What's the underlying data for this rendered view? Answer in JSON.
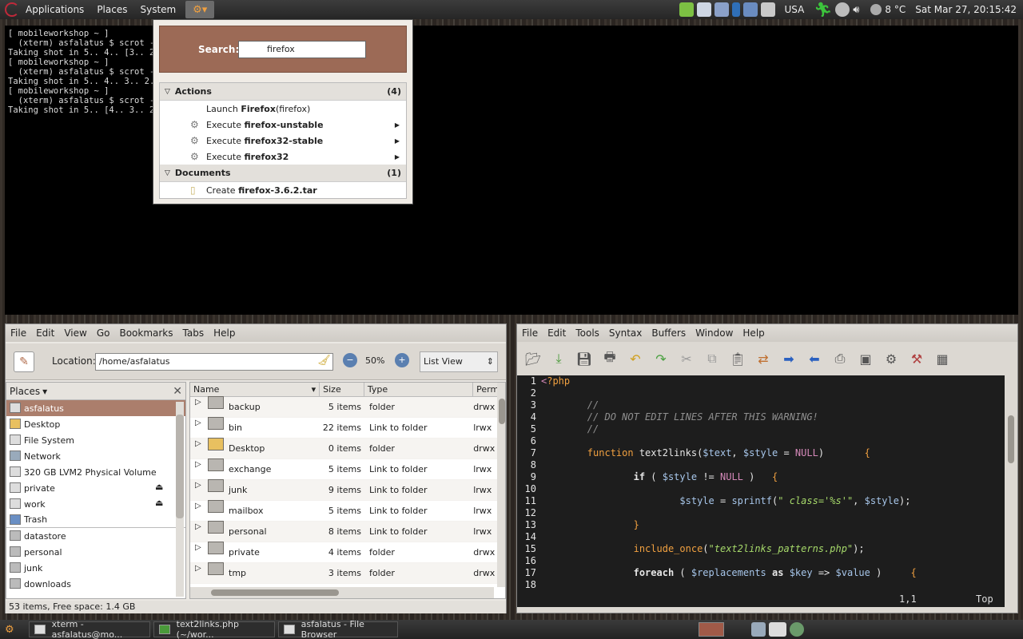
{
  "top_panel": {
    "menus": [
      "Applications",
      "Places",
      "System"
    ],
    "tray": {
      "keyboard": "USA",
      "weather": "8 °C",
      "clock": "Sat Mar 27, 20:15:42"
    }
  },
  "xterm": {
    "lines": [
      "[ mobileworkshop ~ ]",
      "  (xterm) asfalatus $ scrot -c",
      "Taking shot in 5.. 4.. [3.. 2.",
      "[ mobileworkshop ~ ]",
      "  (xterm) asfalatus $ scrot -c",
      "Taking shot in 5.. 4.. 3.. 2..",
      "[ mobileworkshop ~ ]",
      "  (xterm) asfalatus $ scrot -c",
      "Taking shot in 5.. [4.. 3.. 2."
    ]
  },
  "launcher": {
    "search_label": "Search:",
    "search_value": "firefox",
    "groups": [
      {
        "name": "Actions",
        "count": "(4)",
        "items": [
          {
            "verb": "Launch",
            "name": "Firefox",
            "extra": " (firefox)",
            "arrow": false,
            "icon": "none"
          },
          {
            "verb": "Execute",
            "name": "firefox-unstable",
            "extra": "",
            "arrow": true,
            "icon": "gears-icon"
          },
          {
            "verb": "Execute",
            "name": "firefox32-stable",
            "extra": "",
            "arrow": true,
            "icon": "gears-icon"
          },
          {
            "verb": "Execute",
            "name": "firefox32",
            "extra": "",
            "arrow": true,
            "icon": "gears-icon"
          }
        ]
      },
      {
        "name": "Documents",
        "count": "(1)",
        "items": [
          {
            "verb": "Create",
            "name": "firefox-3.6.2.tar",
            "extra": "",
            "arrow": false,
            "icon": "new-document-icon"
          }
        ]
      }
    ]
  },
  "file_browser": {
    "menus": [
      "File",
      "Edit",
      "View",
      "Go",
      "Bookmarks",
      "Tabs",
      "Help"
    ],
    "location_label": "Location:",
    "location": "/home/asfalatus",
    "zoom": "50%",
    "view_mode": "List View",
    "places_label": "Places",
    "places": [
      {
        "label": "asfalatus",
        "selected": true,
        "eject": false
      },
      {
        "label": "Desktop",
        "selected": false,
        "eject": false
      },
      {
        "label": "File System",
        "selected": false,
        "eject": false
      },
      {
        "label": "Network",
        "selected": false,
        "eject": false
      },
      {
        "label": "320 GB LVM2 Physical Volume",
        "selected": false,
        "eject": false
      },
      {
        "label": "private",
        "selected": false,
        "eject": true
      },
      {
        "label": "work",
        "selected": false,
        "eject": true
      },
      {
        "label": "Trash",
        "selected": false,
        "eject": false
      },
      {
        "label": "datastore",
        "selected": false,
        "eject": false
      },
      {
        "label": "personal",
        "selected": false,
        "eject": false
      },
      {
        "label": "junk",
        "selected": false,
        "eject": false
      },
      {
        "label": "downloads",
        "selected": false,
        "eject": false
      }
    ],
    "columns": [
      "Name",
      "Size",
      "Type",
      "Perm"
    ],
    "rows": [
      {
        "name": "backup",
        "size": "5 items",
        "type": "folder",
        "perm": "drwx"
      },
      {
        "name": "bin",
        "size": "22 items",
        "type": "Link to folder",
        "perm": "lrwx"
      },
      {
        "name": "Desktop",
        "size": "0 items",
        "type": "folder",
        "perm": "drwx"
      },
      {
        "name": "exchange",
        "size": "5 items",
        "type": "Link to folder",
        "perm": "lrwx"
      },
      {
        "name": "junk",
        "size": "9 items",
        "type": "Link to folder",
        "perm": "lrwx"
      },
      {
        "name": "mailbox",
        "size": "5 items",
        "type": "Link to folder",
        "perm": "lrwx"
      },
      {
        "name": "personal",
        "size": "8 items",
        "type": "Link to folder",
        "perm": "lrwx"
      },
      {
        "name": "private",
        "size": "4 items",
        "type": "folder",
        "perm": "drwx"
      },
      {
        "name": "tmp",
        "size": "3 items",
        "type": "folder",
        "perm": "drwx"
      }
    ],
    "status": "53 items, Free space: 1.4 GB"
  },
  "editor": {
    "menus": [
      "File",
      "Edit",
      "Tools",
      "Syntax",
      "Buffers",
      "Window",
      "Help"
    ],
    "position": "1,1",
    "scroll": "Top"
  },
  "taskbar": {
    "tasks": [
      "xterm - asfalatus@mo...",
      "text2links.php (~/wor...",
      "asfalatus - File Browser"
    ]
  },
  "colors": {
    "accent": "#ab7e6c",
    "launcher_header": "#9c6a56",
    "code_bg": "#1d1d1d"
  }
}
